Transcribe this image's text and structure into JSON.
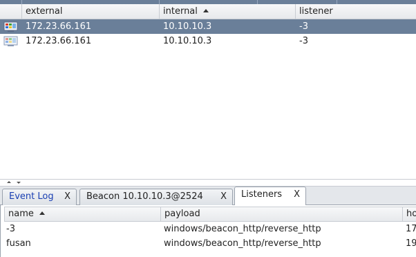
{
  "sessions": {
    "columns": [
      "",
      "external",
      "internal",
      "listener"
    ],
    "rows": [
      {
        "icon": "windows-session-icon",
        "external": "172.23.66.161",
        "internal": "10.10.10.3",
        "listener": "-3",
        "selected": true
      },
      {
        "icon": "windows-session-icon",
        "external": "172.23.66.161",
        "internal": "10.10.10.3",
        "listener": "-3",
        "selected": false
      }
    ]
  },
  "tabs": [
    {
      "label": "Event Log",
      "close": "X",
      "active": false
    },
    {
      "label": "Beacon 10.10.10.3@2524",
      "close": "X",
      "active": false
    },
    {
      "label": "Listeners",
      "close": "X",
      "active": true
    }
  ],
  "listeners": {
    "columns": [
      "name",
      "payload",
      "ho"
    ],
    "rows": [
      {
        "name": "-3",
        "payload": "windows/beacon_http/reverse_http",
        "host": "17"
      },
      {
        "name": "fusan",
        "payload": "windows/beacon_http/reverse_http",
        "host": "19"
      }
    ]
  },
  "colors": {
    "selection": "#6a7f99",
    "event_log_tab": "#1a3fb3"
  }
}
